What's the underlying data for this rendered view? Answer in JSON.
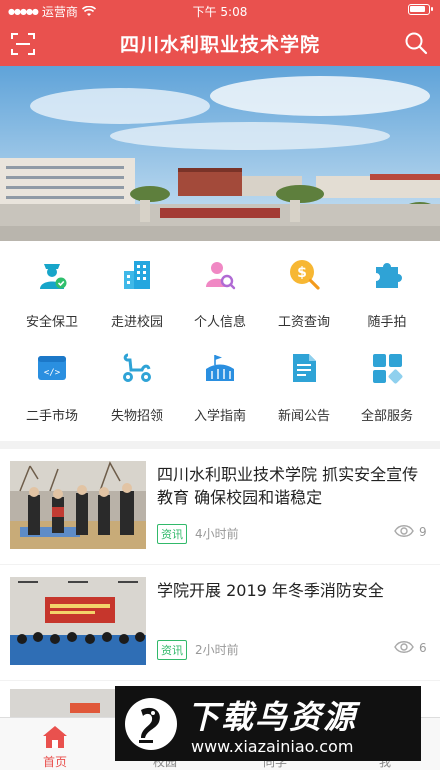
{
  "status_bar": {
    "carrier": "运营商",
    "time": "下午 5:08"
  },
  "header": {
    "title": "四川水利职业技术学院",
    "left_icon": "scan-icon",
    "right_icon": "search-icon"
  },
  "colors": {
    "brand": "#e9514e",
    "tag_green": "#31b96a"
  },
  "services": [
    {
      "label": "安全保卫",
      "icon": "security-guard-icon"
    },
    {
      "label": "走进校园",
      "icon": "building-icon"
    },
    {
      "label": "个人信息",
      "icon": "user-search-icon"
    },
    {
      "label": "工资查询",
      "icon": "salary-search-icon"
    },
    {
      "label": "随手拍",
      "icon": "puzzle-icon"
    },
    {
      "label": "二手市场",
      "icon": "code-window-icon"
    },
    {
      "label": "失物招领",
      "icon": "scooter-icon"
    },
    {
      "label": "入学指南",
      "icon": "stadium-flag-icon"
    },
    {
      "label": "新闻公告",
      "icon": "document-icon"
    },
    {
      "label": "全部服务",
      "icon": "grid-apps-icon"
    }
  ],
  "news": [
    {
      "title": "四川水利职业技术学院  抓实安全宣传教育 确保校园和谐稳定",
      "tag": "资讯",
      "time_ago": "4小时前",
      "views": "9"
    },
    {
      "title": "学院开展 2019 年冬季消防安全",
      "tag": "资讯",
      "time_ago": "2小时前",
      "views": "6"
    }
  ],
  "tabs": [
    {
      "label": "首页",
      "icon": "home-icon",
      "active": true
    },
    {
      "label": "校园",
      "icon": "campus-icon",
      "active": false
    },
    {
      "label": "同学",
      "icon": "classmates-icon",
      "active": false
    },
    {
      "label": "我",
      "icon": "profile-icon",
      "active": false
    }
  ],
  "watermark": {
    "name": "下载鸟资源",
    "url": "www.xiazainiao.com"
  }
}
